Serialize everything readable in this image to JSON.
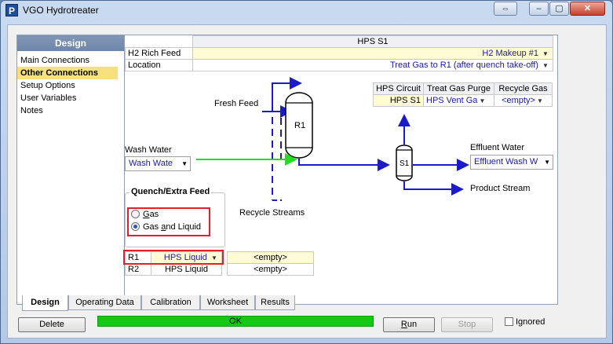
{
  "window": {
    "title": "VGO Hydrotreater",
    "app_icon": "P",
    "controls": {
      "restore": "⇔",
      "minimize": "–",
      "maximize": "▢",
      "close": "✕"
    }
  },
  "nav": {
    "header": "Design",
    "items": [
      "Main Connections",
      "Other Connections",
      "Setup Options",
      "User Variables",
      "Notes"
    ],
    "selected_index": 1
  },
  "hps_table": {
    "header": "HPS S1",
    "rows": [
      {
        "label": "H2 Rich Feed",
        "value": "H2 Makeup #1"
      },
      {
        "label": "Location",
        "value": "Treat Gas to R1 (after quench take-off)"
      }
    ]
  },
  "circuit_table": {
    "headers": [
      "HPS Circuit",
      "Treat Gas Purge",
      "Recycle Gas"
    ],
    "row": [
      "HPS S1",
      "HPS Vent Ga",
      "<empty>"
    ]
  },
  "diagram": {
    "fresh_feed": "Fresh Feed",
    "reactor": "R1",
    "separator": "S1",
    "recycle_streams": "Recycle Streams",
    "product_stream": "Product Stream",
    "stream_color": "#1b1bcc",
    "wash_color": "#22dd22"
  },
  "wash_water": {
    "label": "Wash Water",
    "value": "Wash Wate"
  },
  "effluent_water": {
    "label": "Effluent Water",
    "value": "Effluent Wash W"
  },
  "quench": {
    "title": "Quench/Extra Feed",
    "options": [
      {
        "label_pre": "",
        "label_u": "G",
        "label_post": "as",
        "checked": false
      },
      {
        "label_pre": "Gas ",
        "label_u": "a",
        "label_post": "nd Liquid",
        "checked": true
      }
    ]
  },
  "reactor_table": {
    "rows": [
      {
        "label": "R1",
        "value": "HPS Liquid",
        "extra": "<empty>"
      },
      {
        "label": "R2",
        "value": "HPS Liquid",
        "extra": "<empty>"
      }
    ]
  },
  "tabs": [
    "Design",
    "Operating Data",
    "Calibration",
    "Worksheet",
    "Results"
  ],
  "active_tab": "Design",
  "buttons": {
    "delete": "Delete",
    "run_u": "R",
    "run_rest": "un",
    "stop": "Stop",
    "ignored": "Ignored"
  },
  "status": {
    "text": "OK",
    "color": "#14c814"
  },
  "highlight_color": "#e0202a"
}
